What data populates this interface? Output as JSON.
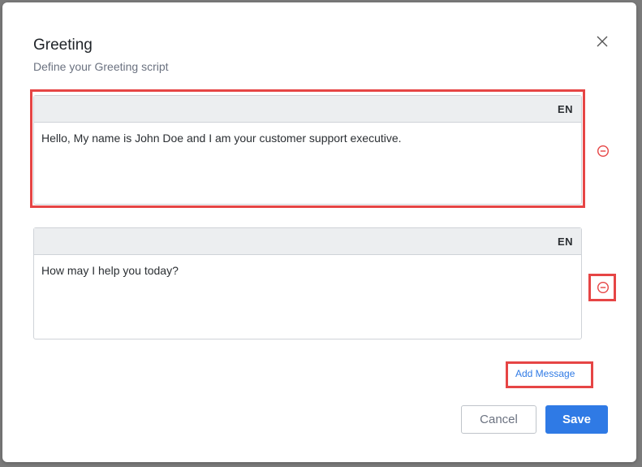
{
  "dialog": {
    "title": "Greeting",
    "subtitle": "Define your Greeting script"
  },
  "messages": [
    {
      "language": "EN",
      "text": "Hello, My name is John Doe and I am your customer support executive."
    },
    {
      "language": "EN",
      "text": "How may I help you today?"
    }
  ],
  "actions": {
    "add_message_label": "Add Message",
    "cancel_label": "Cancel",
    "save_label": "Save"
  },
  "icons": {
    "close": "close-icon",
    "remove": "minus-circle-icon"
  },
  "colors": {
    "accent": "#2f7ae5",
    "highlight": "#e64545",
    "remove_icon": "#e64545"
  }
}
